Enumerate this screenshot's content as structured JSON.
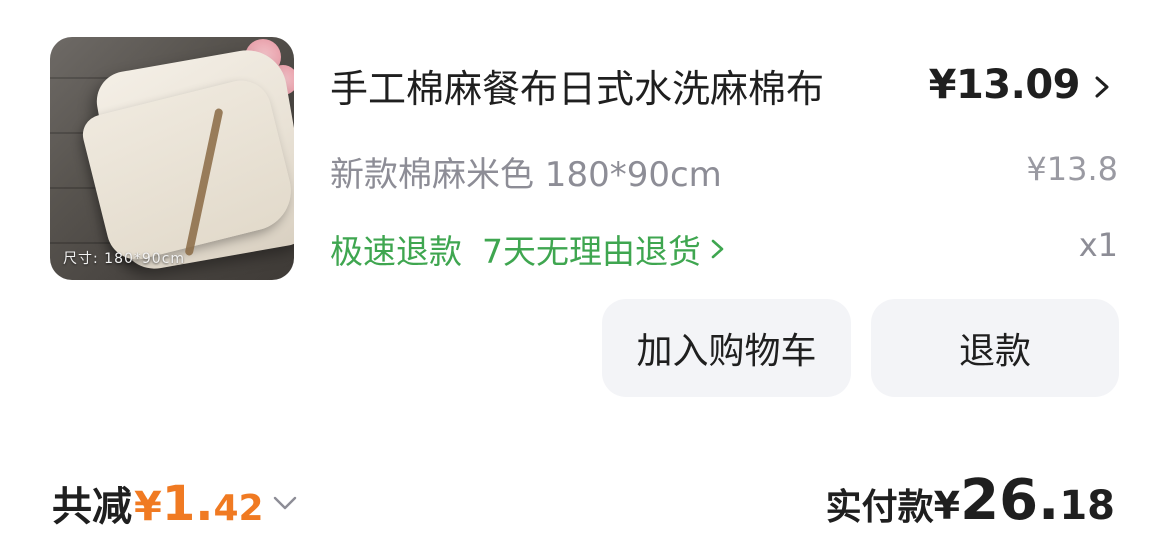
{
  "product": {
    "image_caption": "尺寸: 180*90cm",
    "title": "手工棉麻餐布日式水洗麻棉布",
    "price": "¥13.09",
    "spec": "新款棉麻米色 180*90cm",
    "original_price": "¥13.8",
    "service_refund": "极速退款",
    "service_return": "7天无理由退货",
    "quantity": "x1"
  },
  "actions": {
    "add_to_cart": "加入购物车",
    "refund": "退款"
  },
  "summary": {
    "discount_label": "共减",
    "discount_currency": "¥",
    "discount_int": "1.",
    "discount_dec": "42",
    "paid_label": "实付款",
    "paid_currency": "¥",
    "paid_int": "26.",
    "paid_dec": "18"
  },
  "colors": {
    "accent_orange": "#f07a22",
    "service_green": "#3fa650",
    "button_bg": "#f3f4f7",
    "muted_text": "#8d8d96"
  },
  "icons": [
    "chevron-right-icon",
    "green-chevron-right-icon",
    "chevron-down-icon"
  ]
}
